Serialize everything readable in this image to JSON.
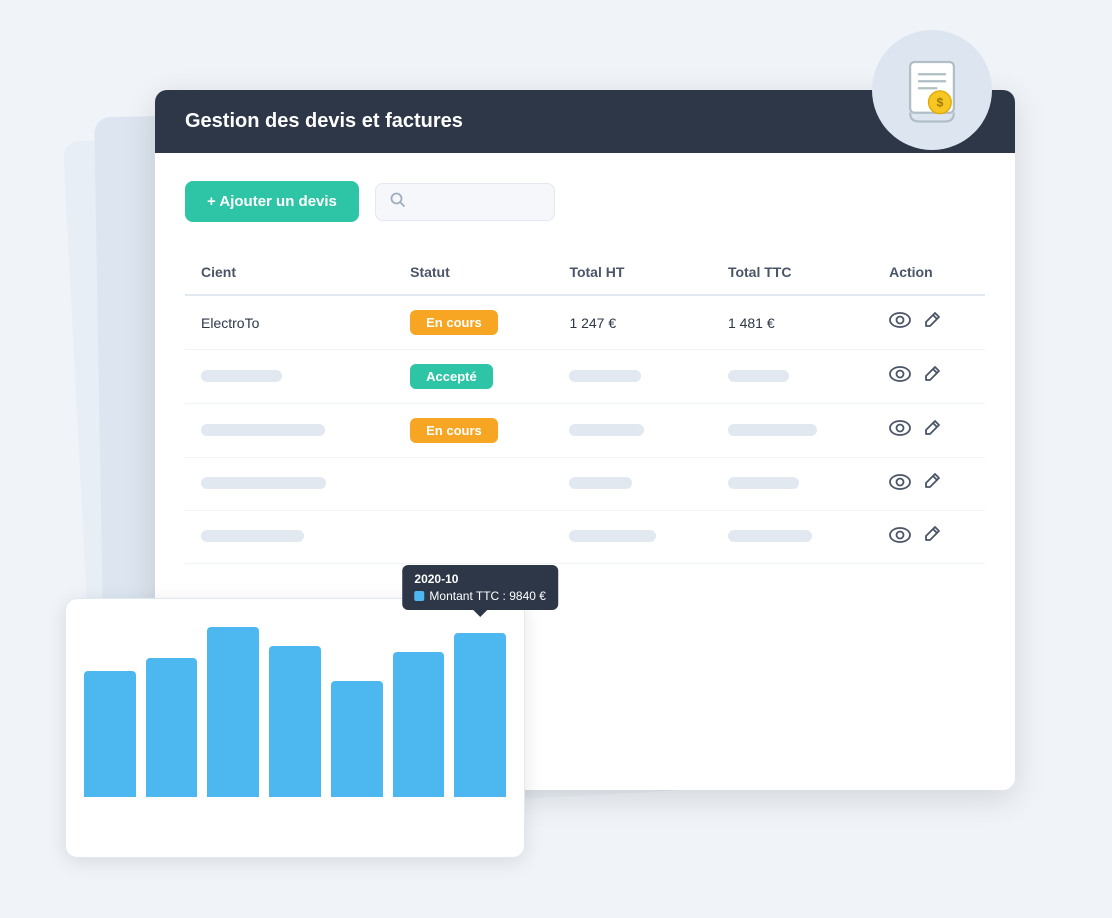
{
  "page": {
    "title": "Gestion des devis et factures"
  },
  "toolbar": {
    "add_label": "+ Ajouter un devis",
    "search_placeholder": ""
  },
  "table": {
    "headers": [
      "Cient",
      "Statut",
      "Total HT",
      "Total TTC",
      "Action"
    ],
    "rows": [
      {
        "client": "ElectroTo",
        "statut": "En cours",
        "statut_type": "encours",
        "total_ht": "1 247 €",
        "total_ttc": "1 481 €",
        "show_data": true
      },
      {
        "client": "",
        "statut": "Accepté",
        "statut_type": "accepte",
        "total_ht": "",
        "total_ttc": "",
        "show_data": false
      },
      {
        "client": "",
        "statut": "En cours",
        "statut_type": "encours",
        "total_ht": "",
        "total_ttc": "",
        "show_data": false
      },
      {
        "client": "",
        "statut": "",
        "statut_type": "",
        "total_ht": "",
        "total_ttc": "",
        "show_data": false
      },
      {
        "client": "",
        "statut": "",
        "statut_type": "",
        "total_ht": "",
        "total_ttc": "",
        "show_data": false
      }
    ]
  },
  "chart": {
    "tooltip": {
      "date": "2020-10",
      "label": "Montant TTC : 9840 €"
    },
    "bars": [
      65,
      72,
      88,
      78,
      60,
      75,
      85
    ],
    "tooltip_bar_index": 6
  }
}
